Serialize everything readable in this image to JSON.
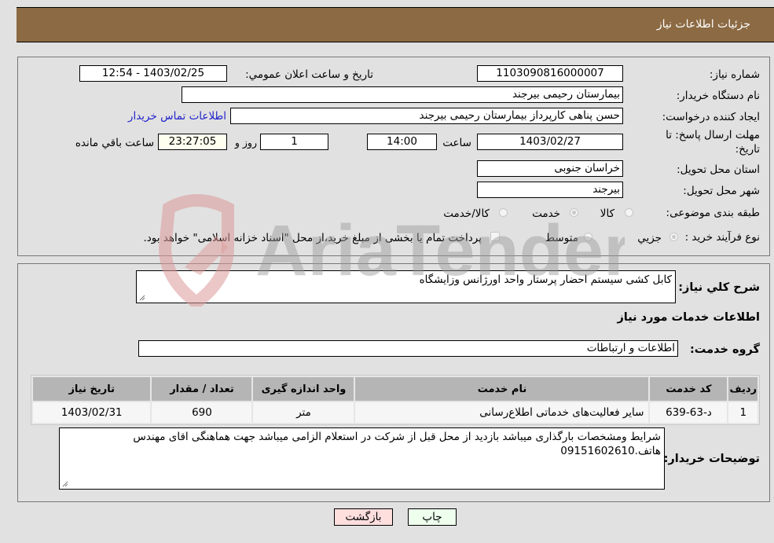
{
  "header": {
    "title": "جزئيات اطلاعات نياز"
  },
  "fields": {
    "need_number": {
      "label": "شماره نياز:",
      "value": "1103090816000007"
    },
    "announce_datetime": {
      "label": "تاريخ و ساعت اعلان عمومي:",
      "value": "1403/02/25 - 12:54"
    },
    "buyer_org": {
      "label": "نام دستگاه خريدار:",
      "value": "بيمارستان رحيمی بيرجند"
    },
    "requester": {
      "label": "ايجاد کننده درخواست:",
      "value": "حسن پناهی کارپرداز  بيمارستان رحيمی بيرجند"
    },
    "buyer_contact_link": "اطلاعات تماس خريدار",
    "deadline": {
      "label_line1": "مهلت ارسال پاسخ: تا",
      "label_line2": "تاريخ:",
      "date": "1403/02/27",
      "time_label": "ساعت",
      "time": "14:00",
      "days": "1",
      "days_label": "روز و",
      "remaining": "23:27:05",
      "remaining_label": "ساعت باقي مانده"
    },
    "province": {
      "label": "استان محل تحويل:",
      "value": "خراسان جنوبی"
    },
    "city": {
      "label": "شهر محل تحويل:",
      "value": "بيرجند"
    },
    "category": {
      "label": "طبقه بندی موضوعی:",
      "options": [
        "کالا",
        "خدمت",
        "کالا/خدمت"
      ],
      "selected": "خدمت"
    },
    "purchase_type": {
      "label": "نوع فرآيند خريد :",
      "options": [
        "جزيي",
        "متوسط"
      ],
      "selected": "جزيي",
      "treasury_note": "پرداخت تمام يا بخشی از مبلغ خريد،از محل \"اسناد خزانه اسلامی\" خواهد بود."
    }
  },
  "details": {
    "general_desc_label": "شرح کلي نياز:",
    "general_desc": "کابل کشی سيستم احضار پرستار واحد اورژانس وزايشگاه",
    "services_title": "اطلاعات خدمات مورد نياز",
    "service_group_label": "گروه خدمت:",
    "service_group": "اطلاعات و ارتباطات",
    "table": {
      "headers": [
        "رديف",
        "کد خدمت",
        "نام خدمت",
        "واحد اندازه گيری",
        "تعداد / مقدار",
        "تاريخ نياز"
      ],
      "rows": [
        [
          "1",
          "د-63-639",
          "ساير فعاليت‌های خدماتی اطلاع‌رسانی",
          "متر",
          "690",
          "1403/02/31"
        ]
      ]
    },
    "buyer_notes_label": "توضيحات خريدار:",
    "buyer_notes": "شرايط ومشخصات بارگذاری ميباشد بازديد از محل قبل از شرکت در استعلام الزامی ميباشد جهت هماهنگی اقای مهندس هاتف.09151602610"
  },
  "buttons": {
    "print": "چاپ",
    "back": "بازگشت"
  },
  "colors": {
    "header_bg": "#8c6a43",
    "print_bg": "#eeffee",
    "back_bg": "#ffdede",
    "link": "#2222cc"
  },
  "watermark": {
    "text": "AriaTender.neT"
  }
}
